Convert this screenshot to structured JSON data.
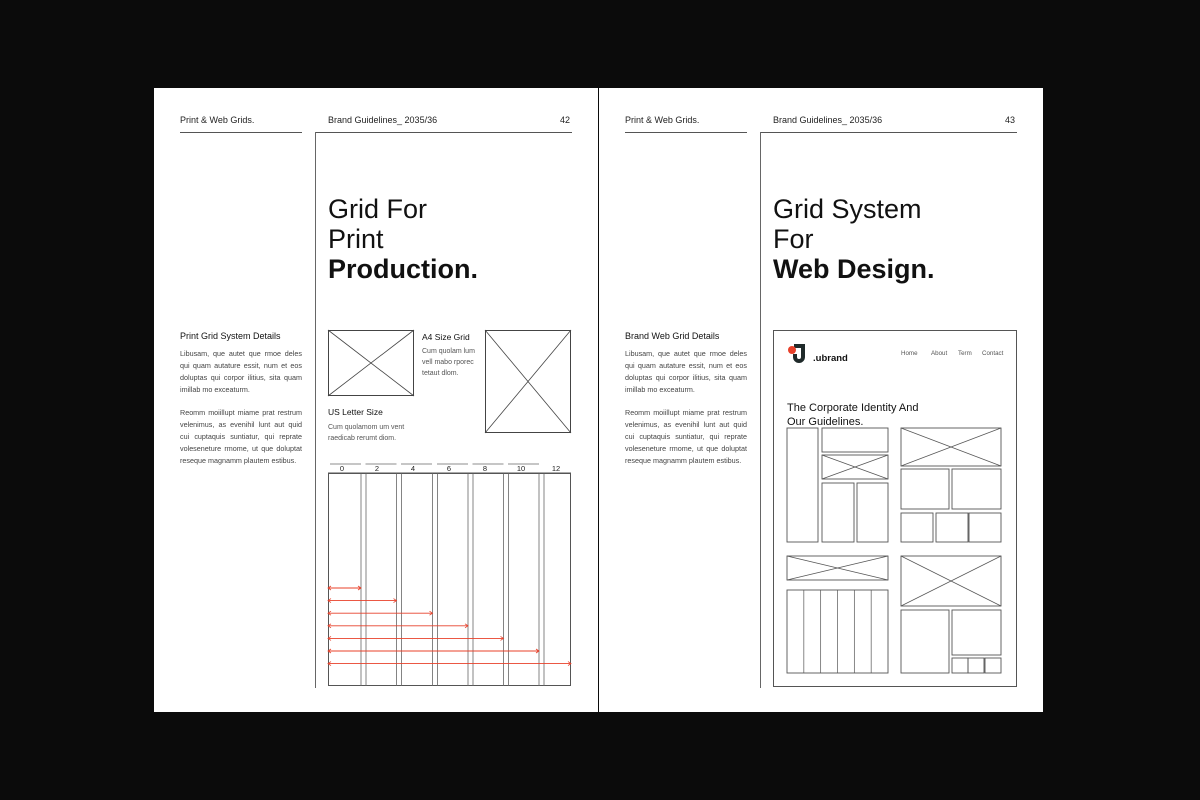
{
  "spread": {
    "left_page": {
      "section_label": "Print & Web Grids.",
      "running_title": "Brand Guidelines_ 2035/36",
      "page_number": "42",
      "title_line1": "Grid For",
      "title_line2": "Print",
      "title_line3": "Production.",
      "details_heading": "Print Grid System Details",
      "details_p1": "Libusam, que autet que rmoe deles qui quam autature essit, num et eos doluptas qui corpor ilitius, sita quam imillab mo exceaturm.",
      "details_p2": "Reomm moiillupt miame prat restrum velenimus, as evenihil lunt aut quid cui cuptaquis suntiatur, qui reprate voleseneture rmome, ut que doluptat reseque magnamm plautem estibus.",
      "a4_label": "A4 Size Grid",
      "a4_text": "Cum quolam lum vell mabo rporec tetaut dlom.",
      "us_label": "US Letter Size",
      "us_text": "Cum quolamom um vent raedicab rerumt diom.",
      "column_ticks": [
        "0",
        "2",
        "4",
        "6",
        "8",
        "10",
        "12"
      ],
      "accent_color": "#e8402a"
    },
    "right_page": {
      "section_label": "Print & Web Grids.",
      "running_title": "Brand Guidelines_ 2035/36",
      "page_number": "43",
      "title_line1": "Grid System",
      "title_line2": "For",
      "title_line3": "Web Design.",
      "details_heading": "Brand Web Grid Details",
      "details_p1": "Libusam, que autet que rmoe deles qui quam autature essit, num et eos doluptas qui corpor ilitius, sita quam imillab mo exceaturm.",
      "details_p2": "Reomm moiillupt miame prat restrum velenimus, as evenihil lunt aut quid cui cuptaquis suntiatur, qui reprate voleseneture rmome, ut que doluptat reseque magnamm plautem estibus.",
      "mockup": {
        "brand_name": ".ubrand",
        "nav_items": [
          "Home",
          "About",
          "Term",
          "Contact"
        ],
        "hero_line1": "The Corporate Identity And",
        "hero_line2": "Our Guidelines.",
        "logo_dark": "#1f2a2a",
        "logo_accent": "#e8402a"
      }
    }
  }
}
